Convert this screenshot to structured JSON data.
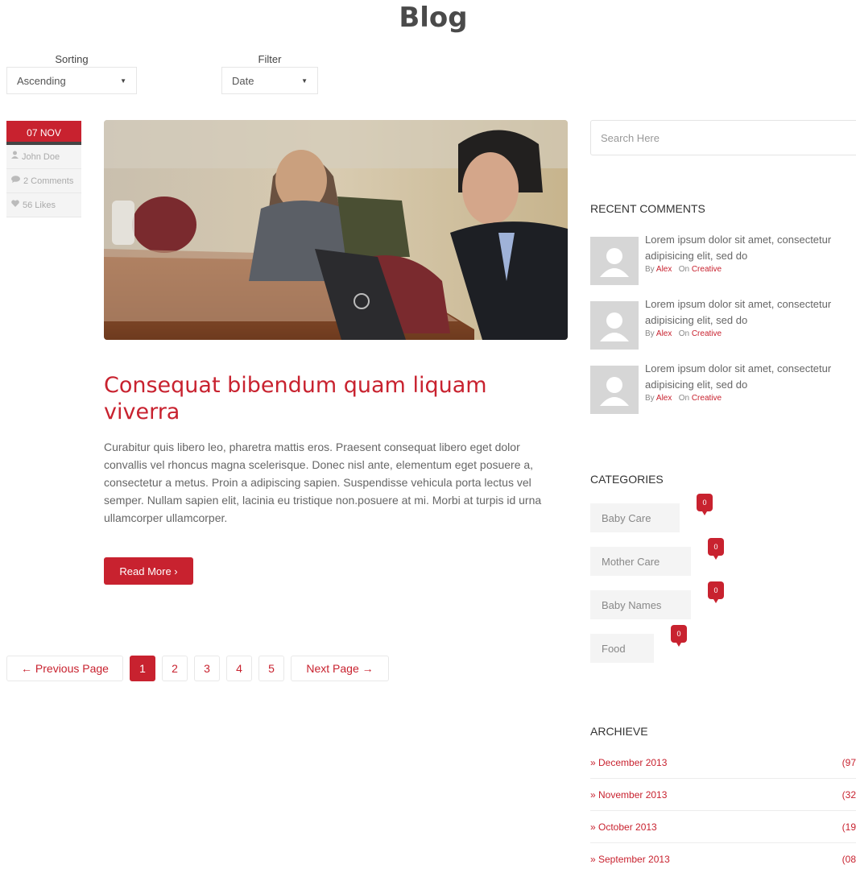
{
  "page": {
    "title": "Blog"
  },
  "controls": {
    "sorting": {
      "label": "Sorting",
      "value": "Ascending"
    },
    "filter": {
      "label": "Filter",
      "value": "Date"
    }
  },
  "post": {
    "date": "07 NOV",
    "author": "John Doe",
    "comments": "2 Comments",
    "likes": "56 Likes",
    "title": "Consequat bibendum quam liquam viverra",
    "body": "Curabitur quis libero leo, pharetra mattis eros. Praesent consequat libero eget dolor convallis vel rhoncus magna scelerisque. Donec nisl ante, elementum eget posuere a, consectetur a metus. Proin a adipiscing sapien. Suspendisse vehicula porta lectus vel semper. Nullam sapien elit, lacinia eu tristique non.posuere at mi. Morbi at turpis id urna ullamcorper ullamcorper.",
    "read_more": "Read More ›"
  },
  "pagination": {
    "prev": "← Previous Page",
    "pages": [
      "1",
      "2",
      "3",
      "4",
      "5"
    ],
    "active": "1",
    "next": "Next Page →"
  },
  "sidebar": {
    "search_placeholder": "Search Here",
    "recent_comments": {
      "title": "RECENT COMMENTS",
      "items": [
        {
          "text": "Lorem ipsum dolor sit amet, consectetur adipisicing elit, sed do",
          "by": "By",
          "author": "Alex",
          "on": "On",
          "category": "Creative"
        },
        {
          "text": "Lorem ipsum dolor sit amet, consectetur adipisicing elit, sed do",
          "by": "By",
          "author": "Alex",
          "on": "On",
          "category": "Creative"
        },
        {
          "text": "Lorem ipsum dolor sit amet, consectetur adipisicing elit, sed do",
          "by": "By",
          "author": "Alex",
          "on": "On",
          "category": "Creative"
        }
      ]
    },
    "categories": {
      "title": "CATEGORIES",
      "items": [
        {
          "label": "Baby Care",
          "count": "0"
        },
        {
          "label": "Mother Care",
          "count": "0"
        },
        {
          "label": "Baby Names",
          "count": "0"
        },
        {
          "label": "Food",
          "count": "0"
        }
      ]
    },
    "archieve": {
      "title": "ARCHIEVE",
      "items": [
        {
          "label": "» December 2013",
          "count": "(97"
        },
        {
          "label": "» November 2013",
          "count": "(32"
        },
        {
          "label": "» October 2013",
          "count": "(19"
        },
        {
          "label": "» September 2013",
          "count": "(08"
        }
      ]
    }
  },
  "colors": {
    "accent": "#c8222f",
    "text": "#666666",
    "muted": "#f4f4f4"
  }
}
